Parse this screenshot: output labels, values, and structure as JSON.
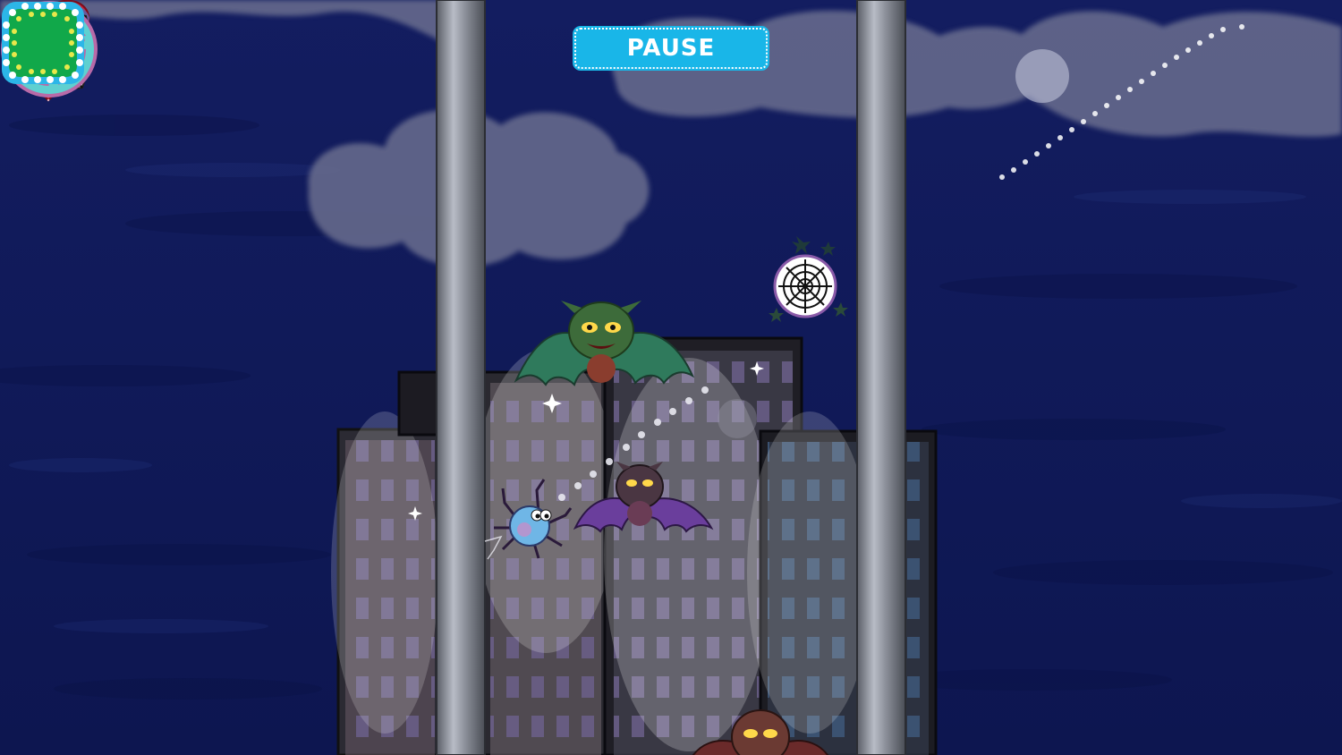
{
  "game": {
    "pause_label": "PAUSE",
    "hud_icons": [
      "heart-lives-icon",
      "spider-web-powerup-icon",
      "swing-arrow-icon",
      "stop-square-icon"
    ],
    "colors": {
      "sky": "#0f1a5a",
      "pause_button": "#19b6e8",
      "heart": "#d12a3a",
      "swing_button": "#5fd0d0",
      "action_button": "#11a84a"
    }
  }
}
